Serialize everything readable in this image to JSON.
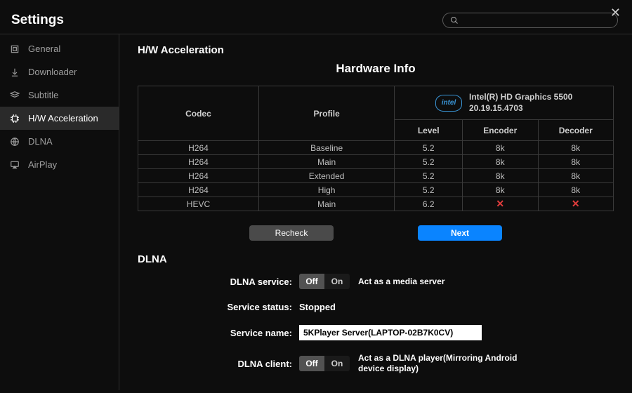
{
  "window": {
    "title": "Settings"
  },
  "search": {
    "placeholder": ""
  },
  "sidebar": {
    "items": [
      {
        "label": "General"
      },
      {
        "label": "Downloader"
      },
      {
        "label": "Subtitle"
      },
      {
        "label": "H/W Acceleration"
      },
      {
        "label": "DLNA"
      },
      {
        "label": "AirPlay"
      }
    ]
  },
  "hw": {
    "section_title": "H/W Acceleration",
    "title": "Hardware Info",
    "gpu_badge": "intel",
    "gpu_name": "Intel(R) HD Graphics 5500",
    "gpu_driver": "20.19.15.4703",
    "headers": {
      "codec": "Codec",
      "profile": "Profile",
      "level": "Level",
      "encoder": "Encoder",
      "decoder": "Decoder"
    },
    "rows": [
      {
        "codec": "H264",
        "profile": "Baseline",
        "level": "5.2",
        "encoder": "8k",
        "decoder": "8k"
      },
      {
        "codec": "H264",
        "profile": "Main",
        "level": "5.2",
        "encoder": "8k",
        "decoder": "8k"
      },
      {
        "codec": "H264",
        "profile": "Extended",
        "level": "5.2",
        "encoder": "8k",
        "decoder": "8k"
      },
      {
        "codec": "H264",
        "profile": "High",
        "level": "5.2",
        "encoder": "8k",
        "decoder": "8k"
      },
      {
        "codec": "HEVC",
        "profile": "Main",
        "level": "6.2",
        "encoder": "✕",
        "decoder": "✕"
      }
    ],
    "buttons": {
      "recheck": "Recheck",
      "next": "Next"
    }
  },
  "dlna": {
    "section_title": "DLNA",
    "service_label": "DLNA service:",
    "service_desc": "Act as a media server",
    "status_label": "Service status:",
    "status_value": "Stopped",
    "name_label": "Service name:",
    "name_value": "5KPlayer Server(LAPTOP-02B7K0CV)",
    "client_label": "DLNA client:",
    "client_desc": "Act as a DLNA player(Mirroring Android device display)",
    "toggle": {
      "off": "Off",
      "on": "On"
    }
  }
}
